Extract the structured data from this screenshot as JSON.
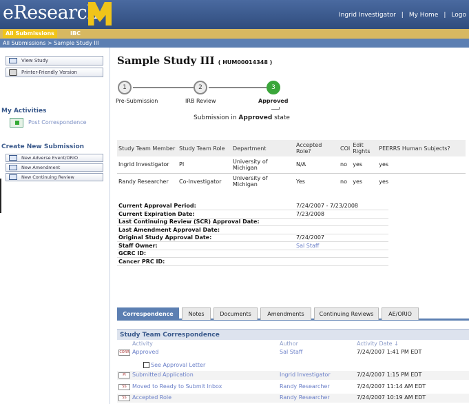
{
  "header": {
    "logo_text": "eResearch",
    "user_links": [
      "Ingrid Investigator",
      "|",
      "My Home",
      "|",
      "Logo"
    ]
  },
  "topnav": {
    "all_submissions": "All Submissions",
    "ibc": "IBC"
  },
  "breadcrumb": "All Submissions  >  Sample Study III",
  "sidebar": {
    "buttons": [
      "View Study",
      "Printer-Friendly Version"
    ],
    "activities_heading": "My Activities",
    "post_correspondence": "Post Correspondence",
    "new_submission_heading": "Create New Submission",
    "new_buttons": [
      "New Adverse Event/ORIO",
      "New Amendment",
      "New Continuing Review"
    ]
  },
  "study": {
    "title": "Sample Study III",
    "id": "( HUM00014348 )"
  },
  "workflow": {
    "steps": [
      {
        "num": "1",
        "label": "Pre-Submission"
      },
      {
        "num": "2",
        "label": "IRB Review"
      },
      {
        "num": "3",
        "label": "Approved"
      }
    ],
    "status_prefix": "Submission in ",
    "status_state": "Approved",
    "status_suffix": " state"
  },
  "team": {
    "headers": [
      "Study Team Member",
      "Study Team Role",
      "Department",
      "Accepted Role?",
      "COI",
      "Edit Rights",
      "PEERRS Human Subjects?"
    ],
    "rows": [
      {
        "member": "Ingrid Investigator",
        "role": "PI",
        "dept": "University of Michigan",
        "accepted": "N/A",
        "coi": "no",
        "edit": "yes",
        "peerrs": "yes"
      },
      {
        "member": "Randy Researcher",
        "role": "Co-Investigator",
        "dept": "University of Michigan",
        "accepted": "Yes",
        "coi": "no",
        "edit": "yes",
        "peerrs": "yes"
      }
    ]
  },
  "details": [
    {
      "k": "Current Approval Period:",
      "v": "7/24/2007 - 7/23/2008"
    },
    {
      "k": "Current Expiration Date:",
      "v": "7/23/2008"
    },
    {
      "k": "Last Continuing Review (SCR) Approval Date:",
      "v": ""
    },
    {
      "k": "Last Amendment Approval Date:",
      "v": ""
    },
    {
      "k": "Original Study Approval Date:",
      "v": "7/24/2007"
    },
    {
      "k": "Staff Owner:",
      "v": "Sal Staff"
    },
    {
      "k": "GCRC ID:",
      "v": ""
    },
    {
      "k": "Cancer PRC ID:",
      "v": ""
    }
  ],
  "tabs": [
    "Correspondence",
    "Notes",
    "Documents",
    "Amendments",
    "Continuing Reviews",
    "AE/ORIO"
  ],
  "correspondence": {
    "heading": "Study Team Correspondence",
    "columns": [
      "Activity",
      "Author",
      "Activity Date ↓"
    ],
    "see_letter": "See Approval Letter",
    "rows": [
      {
        "tag": "CORR",
        "activity": "Approved",
        "author": "Sal Staff",
        "date": "7/24/2007 1:41 PM EDT"
      },
      {
        "tag": "PI",
        "activity": "Submitted Application",
        "author": "Ingrid Investigator",
        "date": "7/24/2007 1:15 PM EDT"
      },
      {
        "tag": "SS",
        "activity": "Moved to Ready to Submit Inbox",
        "author": "Randy Researcher",
        "date": "7/24/2007 11:14 AM EDT"
      },
      {
        "tag": "SS",
        "activity": "Accepted Role",
        "author": "Randy Researcher",
        "date": "7/24/2007 10:19 AM EDT"
      }
    ]
  }
}
